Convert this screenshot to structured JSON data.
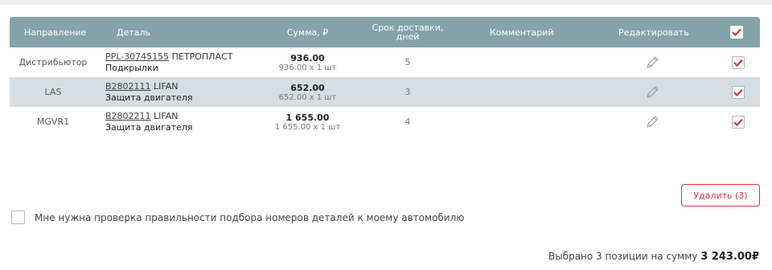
{
  "colors": {
    "header_bg": "#86a3aa",
    "alt_row_bg": "#d6dee1",
    "accent_red": "#d23a40"
  },
  "table": {
    "headers": {
      "direction": "Направление",
      "detail": "Деталь",
      "sum": "Сумма, ₽",
      "delivery_line1": "Срок доставки,",
      "delivery_line2": "дней",
      "comment": "Комментарий",
      "edit": "Редактировать"
    },
    "rows": [
      {
        "direction": "Дистрибьютор",
        "code": "PPL-30745155",
        "brand": "ПЕТРОПЛАСТ",
        "name": "Подкрылки",
        "total": "936.00",
        "unit": "936.00 x 1 шт",
        "days": "5",
        "checked": true
      },
      {
        "direction": "LAS",
        "code": "B2802111",
        "brand": "LIFAN",
        "name": "Защита двигателя",
        "total": "652.00",
        "unit": "652.00 x 1 шт",
        "days": "3",
        "checked": true
      },
      {
        "direction": "MGVR1",
        "code": "B2802211",
        "brand": "LIFAN",
        "name": "Защита двигателя",
        "total": "1 655.00",
        "unit": "1 655.00 x 1 шт",
        "days": "4",
        "checked": true
      }
    ]
  },
  "delete_button": "Удалить (3)",
  "verify_label": "Мне нужна проверка правильности подбора номеров деталей к моему автомобилю",
  "summary": {
    "text": "Выбрано 3 позиции на сумму",
    "amount": "3 243.00₽"
  },
  "icons": {
    "edit": "pencil-icon",
    "check": "checkmark-icon"
  }
}
